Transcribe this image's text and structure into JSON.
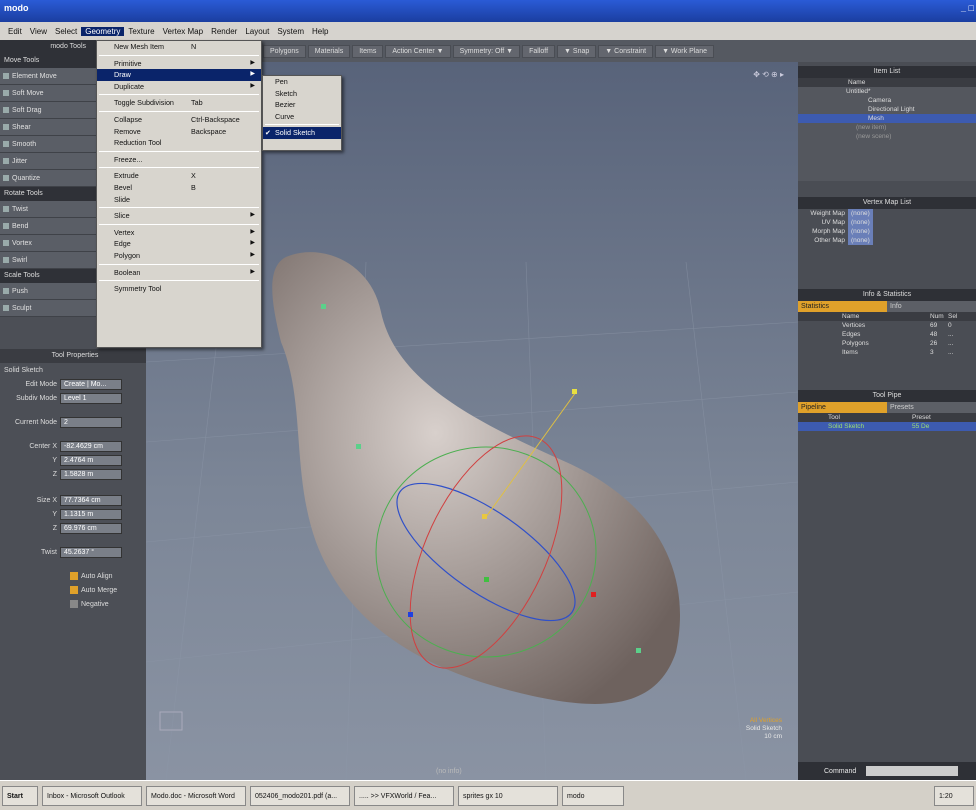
{
  "window": {
    "title": "modo",
    "controls": "_ □"
  },
  "menubar": [
    "Edit",
    "View",
    "Select",
    "Geometry",
    "Texture",
    "Vertex Map",
    "Render",
    "Layout",
    "System",
    "Help"
  ],
  "geometry_menu": [
    {
      "label": "New Mesh Item",
      "shortcut": "N"
    },
    {
      "sep": true
    },
    {
      "label": "Primitive",
      "sub": true
    },
    {
      "label": "Draw",
      "sub": true,
      "hl": true
    },
    {
      "label": "Duplicate",
      "sub": true
    },
    {
      "sep": true
    },
    {
      "label": "Toggle Subdivision",
      "shortcut": "Tab"
    },
    {
      "sep": true
    },
    {
      "label": "Collapse",
      "shortcut": "Ctrl-Backspace"
    },
    {
      "label": "Remove",
      "shortcut": "Backspace"
    },
    {
      "label": "Reduction Tool"
    },
    {
      "sep": true
    },
    {
      "label": "Freeze..."
    },
    {
      "sep": true
    },
    {
      "label": "Extrude",
      "shortcut": "X"
    },
    {
      "label": "Bevel",
      "shortcut": "B"
    },
    {
      "label": "Slide"
    },
    {
      "sep": true
    },
    {
      "label": "Slice",
      "sub": true
    },
    {
      "sep": true
    },
    {
      "label": "Vertex",
      "sub": true
    },
    {
      "label": "Edge",
      "sub": true
    },
    {
      "label": "Polygon",
      "sub": true
    },
    {
      "sep": true
    },
    {
      "label": "Boolean",
      "sub": true
    },
    {
      "sep": true
    },
    {
      "label": "Symmetry Tool"
    }
  ],
  "draw_submenu": [
    "Pen",
    "Sketch",
    "Bezier",
    "Curve",
    "Solid Sketch"
  ],
  "toolbar": [
    "Polygons",
    "Materials",
    "Items",
    "Action Center ▼",
    "Symmetry: Off ▼",
    "Falloff",
    "▼ Snap",
    "▼ Constraint",
    "▼ Work Plane"
  ],
  "left": {
    "header1": "modo Tools",
    "move_head": "Move Tools",
    "move": [
      "Element Move",
      "Soft Move",
      "Soft Drag",
      "Shear",
      "Smooth",
      "Jitter",
      "Quantize"
    ],
    "rotate_head": "Rotate Tools",
    "rotate": [
      "Twist",
      "Bend",
      "Vortex",
      "Swirl"
    ],
    "scale_head": "Scale Tools",
    "scale": [
      "Push",
      "Sculpt"
    ],
    "tool_props": "Tool Properties",
    "tool_name": "Solid Sketch",
    "edit_mode_l": "Edit Mode",
    "edit_mode": "Create | Mo...",
    "subdiv_l": "Subdiv Mode",
    "subdiv": "Level 1",
    "cur_node_l": "Current Node",
    "cur_node": "2",
    "center_l": "Center X",
    "cx": "-82.4629 cm",
    "cy": "2.4764 m",
    "cz": "1.5828 m",
    "size_l": "Size X",
    "sx": "77.7364 cm",
    "sy": "1.1315 m",
    "sz": "69.976 cm",
    "twist_l": "Twist",
    "twist": "45.2637 °",
    "checks": [
      "Auto Align",
      "Auto Merge",
      "Negative"
    ]
  },
  "viewport": {
    "info": "(no info)",
    "corner1": "All Vertices",
    "corner2": "Solid Sketch",
    "corner3": "10 cm"
  },
  "right": {
    "item_list": "Item List",
    "name_col": "Name",
    "items": [
      "Untitled*",
      "Camera",
      "Directional Light",
      "Mesh",
      "(new item)",
      "(new scene)"
    ],
    "vmap_head": "Vertex Map List",
    "vmaps": [
      [
        "Weight Map",
        "(none)"
      ],
      [
        "UV Map",
        "(none)"
      ],
      [
        "Morph Map",
        "(none)"
      ],
      [
        "Other Map",
        "(none)"
      ]
    ],
    "info_head": "Info & Statistics",
    "info_tabs": [
      "Statistics",
      "Info"
    ],
    "stats_cols": [
      "Name",
      "Num",
      "Sel"
    ],
    "stats": [
      [
        "Vertices",
        "69",
        "0"
      ],
      [
        "Edges",
        "48",
        "..."
      ],
      [
        "Polygons",
        "26",
        "..."
      ],
      [
        "Items",
        "3",
        "..."
      ]
    ],
    "pipe_head": "Tool Pipe",
    "pipe_tabs": [
      "Pipeline",
      "Presets"
    ],
    "pipe_cols": [
      "Tool",
      "Preset"
    ],
    "pipe_row": [
      "Solid Sketch",
      "55 De"
    ],
    "command": "Command"
  },
  "taskbar": [
    "Start",
    "Inbox - Microsoft Outlook",
    "Modo.doc - Microsoft Word",
    "052406_modo201.pdf (a...",
    "..... >> VFXWorld / Fea...",
    "sprites gx 10",
    "modo",
    "1:20"
  ]
}
